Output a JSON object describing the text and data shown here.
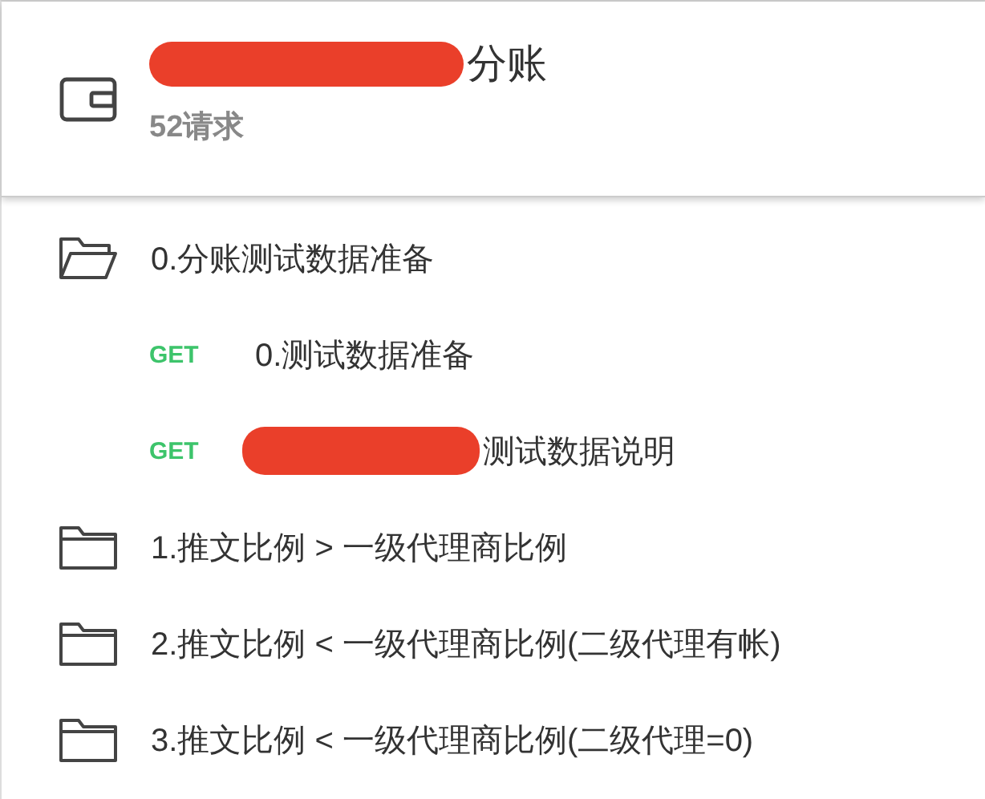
{
  "collection": {
    "name": "分账",
    "redacted": true,
    "count": "52请求"
  },
  "items": [
    {
      "kind": "folder",
      "name": "0.分账测试数据准备",
      "expanded": true
    },
    {
      "kind": "request",
      "method": "GET",
      "name": "0.测试数据准备",
      "redacted": false
    },
    {
      "kind": "request",
      "method": "GET",
      "name": "测试数据说明",
      "redacted": true
    },
    {
      "kind": "folder",
      "name": "1.推文比例 > 一级代理商比例",
      "expanded": false
    },
    {
      "kind": "folder",
      "name": "2.推文比例 < 一级代理商比例(二级代理有帐)",
      "expanded": false
    },
    {
      "kind": "folder",
      "name": "3.推文比例 < 一级代理商比例(二级代理=0)",
      "expanded": false
    }
  ]
}
